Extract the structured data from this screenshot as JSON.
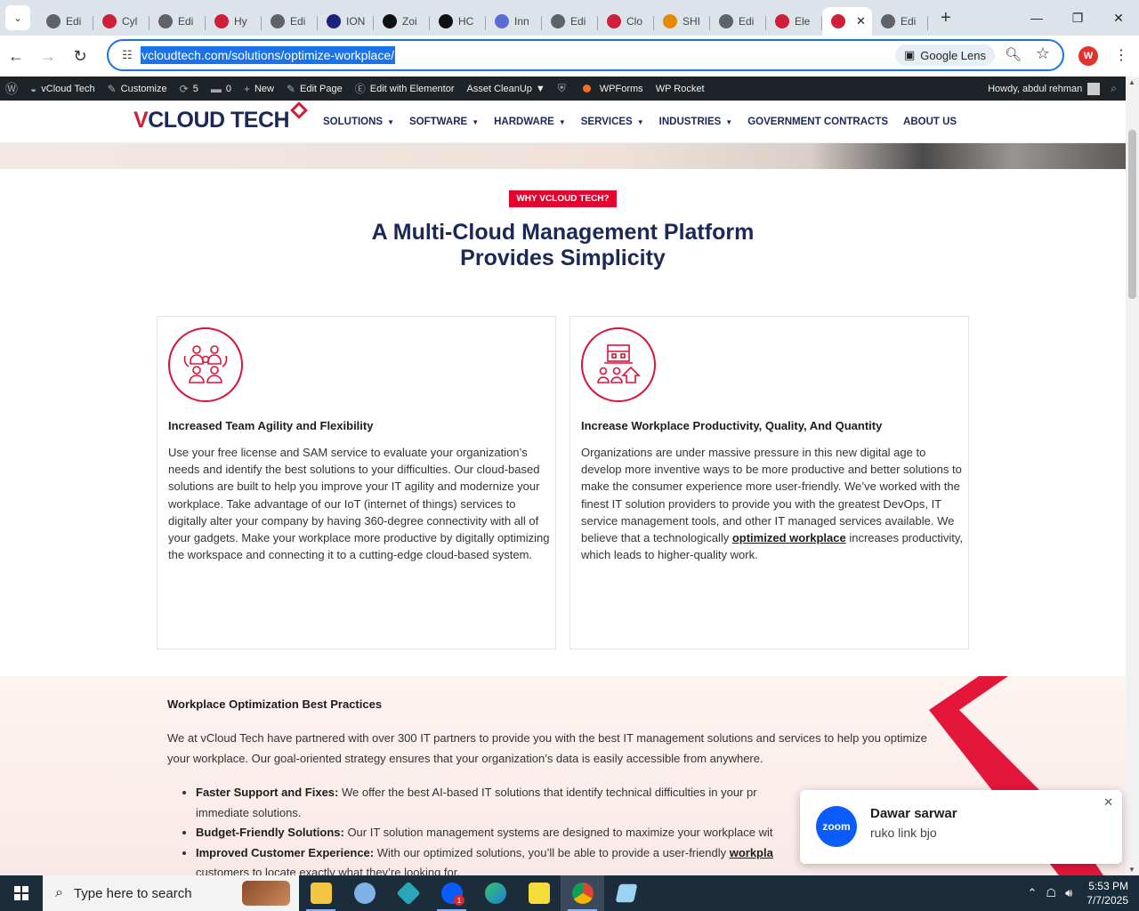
{
  "browser": {
    "tabs": [
      {
        "label": "Edi",
        "fav": "globe",
        "color": "#5f6368"
      },
      {
        "label": "Cyl",
        "fav": "vcloud",
        "color": "#cf1f3a"
      },
      {
        "label": "Edi",
        "fav": "globe",
        "color": "#5f6368"
      },
      {
        "label": "Hy",
        "fav": "vcloud",
        "color": "#cf1f3a"
      },
      {
        "label": "Edi",
        "fav": "globe",
        "color": "#5f6368"
      },
      {
        "label": "ION",
        "fav": "N",
        "color": "#1a237e"
      },
      {
        "label": "Zoi",
        "fav": "Z",
        "color": "#111111"
      },
      {
        "label": "HC",
        "fav": "openai",
        "color": "#111111"
      },
      {
        "label": "Inn",
        "fav": "wave",
        "color": "#5b6bd6"
      },
      {
        "label": "Edi",
        "fav": "globe",
        "color": "#5f6368"
      },
      {
        "label": "Clo",
        "fav": "swoosh",
        "color": "#cf1f3a"
      },
      {
        "label": "SHI",
        "fav": "ring",
        "color": "#e58a00"
      },
      {
        "label": "Edi",
        "fav": "globe",
        "color": "#5f6368"
      },
      {
        "label": "Ele",
        "fav": "vcloud",
        "color": "#cf1f3a"
      },
      {
        "label": "",
        "fav": "vcloud",
        "color": "#cf1f3a",
        "active": true
      },
      {
        "label": "Edi",
        "fav": "wp",
        "color": "#5f6368"
      }
    ],
    "url": "vcloudtech.com/solutions/optimize-workplace/",
    "lens_label": "Google Lens",
    "profile_initial": "W"
  },
  "adminbar": {
    "site": "vCloud Tech",
    "customize": "Customize",
    "updates": "5",
    "comments": "0",
    "new": "New",
    "edit_page": "Edit Page",
    "elementor": "Edit with Elementor",
    "asset_cleanup": "Asset CleanUp",
    "wpforms": "WPForms",
    "wprocket": "WP Rocket",
    "howdy": "Howdy, abdul rehman"
  },
  "site": {
    "logo_v": "V",
    "logo_rest": "CLOUD TECH",
    "nav": [
      {
        "label": "SOLUTIONS",
        "dropdown": true
      },
      {
        "label": "SOFTWARE",
        "dropdown": true
      },
      {
        "label": "HARDWARE",
        "dropdown": true
      },
      {
        "label": "SERVICES",
        "dropdown": true
      },
      {
        "label": "INDUSTRIES",
        "dropdown": true
      },
      {
        "label": "GOVERNMENT CONTRACTS",
        "dropdown": false
      },
      {
        "label": "ABOUT US",
        "dropdown": false
      }
    ]
  },
  "section1": {
    "badge": "WHY VCLOUD TECH?",
    "heading_line1": "A Multi-Cloud Management Platform",
    "heading_line2": "Provides Simplicity",
    "card1": {
      "title": "Increased Team Agility and Flexibility",
      "body": "Use your free license and SAM service to evaluate your organization’s needs and identify the best solutions to your difficulties. Our cloud-based solutions are built to help you improve your IT agility and modernize your workplace. Take advantage of our IoT (internet of things) services to digitally alter your company by having 360-degree connectivity with all of your gadgets. Make your workplace more productive by digitally optimizing the workspace and connecting it to a cutting-edge cloud-based system."
    },
    "card2": {
      "title": "Increase Workplace Productivity, Quality, And Quantity",
      "body_before": "Organizations are under massive pressure in this new digital age to develop more inventive ways to be more productive and better solutions to make the consumer experience more user-friendly. We’ve worked with the finest IT solution providers to provide you with the greatest DevOps, IT service management tools, and other IT managed services available. We believe that a technologically ",
      "link": "optimized workplace",
      "body_after": " increases productivity, which leads to higher-quality work."
    }
  },
  "section2": {
    "title": "Workplace Optimization Best Practices",
    "para": "We at vCloud Tech have partnered with over 300 IT partners to provide you with the best IT management solutions and services to help you optimize your workplace. Our goal-oriented strategy ensures that your organization’s data is easily accessible from anywhere.",
    "items": [
      {
        "bold": "Faster Support and Fixes:",
        "text": " We offer the best AI-based IT solutions that identify technical difficulties in your pr",
        "text2": "immediate solutions."
      },
      {
        "bold": "Budget-Friendly Solutions:",
        "text": " Our IT solution management systems are designed to maximize your workplace wit"
      },
      {
        "bold": "Improved Customer Experience:",
        "text": " With our optimized solutions, you’ll be able to provide a user-friendly ",
        "link": "workpla",
        "text2": "customers to locate exactly what they’re looking for."
      }
    ]
  },
  "toast": {
    "logo": "zoom",
    "name": "Dawar sarwar",
    "message": "ruko link bjo"
  },
  "taskbar": {
    "search_placeholder": "Type here to search",
    "time": "5:53 PM",
    "date": "7/7/2025",
    "zoom_badge": "1"
  },
  "colors": {
    "brand_red": "#cf1f3a",
    "brand_navy": "#1c2957",
    "badge_red": "#e4032e",
    "chrome_blue": "#1a73e8"
  }
}
